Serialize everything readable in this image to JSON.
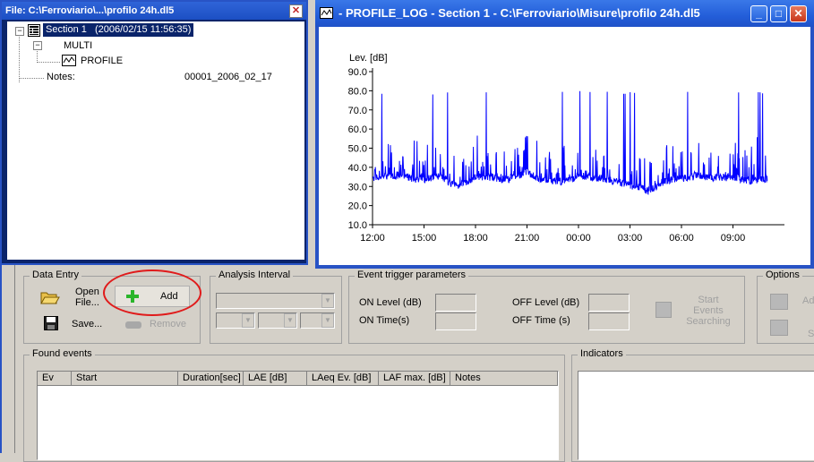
{
  "tree_window": {
    "title": "File: C:\\Ferroviario\\...\\profilo 24h.dl5",
    "close_glyph": "✕",
    "section_label": "Section 1",
    "section_date": "(2006/02/15 11:56:35)",
    "multi_label": "MULTI",
    "profile_label": "PROFILE",
    "notes_label": "Notes:",
    "notes_value": "00001_2006_02_17"
  },
  "chart_window": {
    "title": "- PROFILE_LOG - Section 1 -  C:\\Ferroviario\\Misure\\profilo 24h.dl5",
    "btn_minimize": "_",
    "btn_maximize": "□",
    "btn_close": "✕"
  },
  "chart_data": {
    "type": "line",
    "ylabel": "Lev. [dB]",
    "ylim": [
      10,
      90
    ],
    "y_ticks": [
      "10.0",
      "20.0",
      "30.0",
      "40.0",
      "50.0",
      "60.0",
      "70.0",
      "80.0",
      "90.0"
    ],
    "x_ticks": [
      "12:00",
      "15:00",
      "18:00",
      "21:00",
      "00:00",
      "03:00",
      "06:00",
      "09:00"
    ],
    "series_color": "#0000ff",
    "series": [
      {
        "x_hours": [
          0,
          0.5,
          1,
          1.5,
          2,
          2.5,
          3,
          3.5,
          4,
          4.5,
          5,
          5.5,
          6,
          6.5,
          7,
          7.5,
          8,
          8.5,
          9,
          9.5,
          10,
          10.5,
          11,
          11.5,
          12,
          12.5,
          13,
          13.5,
          14,
          14.5,
          15,
          15.5,
          16,
          16.5,
          17,
          17.5,
          18,
          18.5,
          19,
          19.5,
          20,
          20.5,
          21,
          21.5,
          22,
          22.5,
          23
        ],
        "base": [
          33,
          34,
          35,
          35,
          34,
          33,
          33,
          34,
          35,
          31,
          30,
          32,
          34,
          34,
          34,
          33,
          33,
          35,
          37,
          34,
          32,
          32,
          32,
          33,
          34,
          34,
          34,
          33,
          32,
          31,
          30,
          28,
          27,
          29,
          32,
          33,
          33,
          34,
          35,
          34,
          34,
          34,
          34,
          33,
          32,
          33,
          33
        ],
        "peak": [
          45,
          55,
          52,
          48,
          50,
          56,
          58,
          52,
          50,
          48,
          45,
          55,
          60,
          52,
          54,
          50,
          48,
          52,
          58,
          55,
          50,
          48,
          52,
          50,
          48,
          45,
          50,
          48,
          46,
          44,
          40,
          45,
          50,
          44,
          50,
          56,
          65,
          52,
          55,
          50,
          48,
          52,
          55,
          50,
          50,
          58,
          60
        ]
      }
    ]
  },
  "data_entry": {
    "legend": "Data Entry",
    "open_file": [
      "Open",
      "File..."
    ],
    "add": "Add",
    "save": "Save...",
    "remove": "Remove"
  },
  "analysis_interval": {
    "legend": "Analysis Interval"
  },
  "event_trigger": {
    "legend": "Event trigger parameters",
    "on_level": "ON Level (dB)",
    "on_time": "ON Time(s)",
    "off_level": "OFF Level (dB)",
    "off_time": "OFF Time (s)",
    "start_search": [
      "Start",
      "Events",
      "Searching"
    ]
  },
  "options": {
    "legend": "Options",
    "add_partial": "Ad",
    "s_partial": "S"
  },
  "found_events": {
    "legend": "Found events",
    "columns": [
      "Ev",
      "Start",
      "Duration[sec]",
      "LAE [dB]",
      "LAeq Ev. [dB]",
      "LAF max. [dB]",
      "Notes"
    ]
  },
  "indicators": {
    "legend": "Indicators"
  }
}
